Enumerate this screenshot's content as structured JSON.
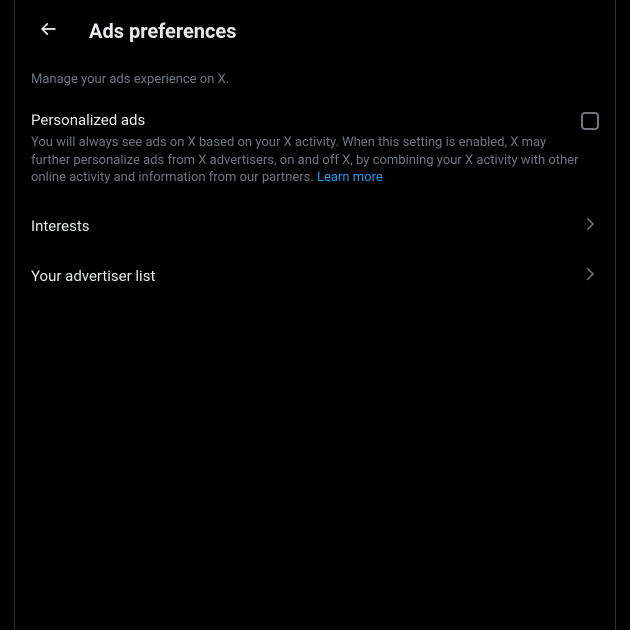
{
  "header": {
    "title": "Ads preferences"
  },
  "subtitle": "Manage your ads experience on X.",
  "personalized": {
    "title": "Personalized ads",
    "description": "You will always see ads on X based on your X activity. When this setting is enabled, X may further personalize ads from X advertisers, on and off X, by combining your X activity with other online activity and information from our partners. ",
    "learn_more": "Learn more",
    "checked": false
  },
  "nav": {
    "interests": "Interests",
    "advertiser_list": "Your advertiser list"
  }
}
